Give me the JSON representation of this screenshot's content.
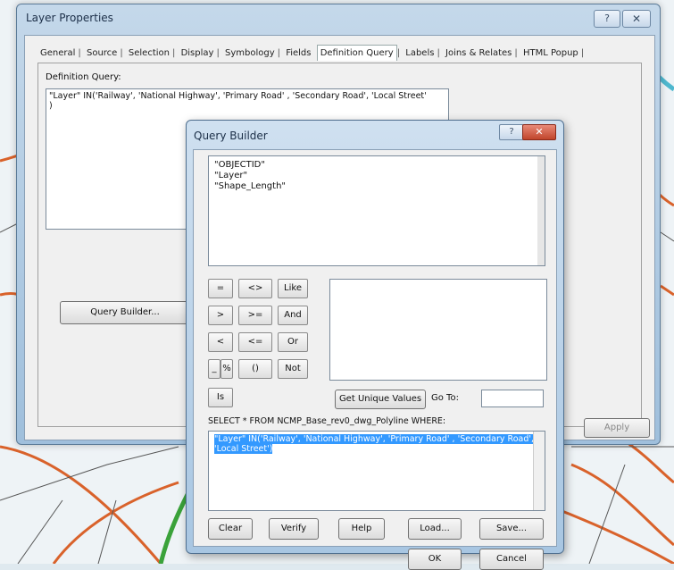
{
  "layer_properties": {
    "title": "Layer Properties",
    "help_glyph": "?",
    "close_glyph": "✕",
    "tabs": [
      "General",
      "Source",
      "Selection",
      "Display",
      "Symbology",
      "Fields",
      "Definition Query",
      "Labels",
      "Joins & Relates",
      "HTML Popup"
    ],
    "active_tab": "Definition Query",
    "definition_query_label": "Definition Query:",
    "definition_query_text": "\"Layer\" IN('Railway', 'National Highway', 'Primary Road' , 'Secondary Road', 'Local Street'",
    "definition_query_text_line2": ")",
    "query_builder_button": "Query Builder...",
    "apply_button": "Apply"
  },
  "query_builder": {
    "title": "Query Builder",
    "help_glyph": "?",
    "close_glyph": "✕",
    "fields": [
      "\"OBJECTID\"",
      "\"Layer\"",
      "\"Shape_Length\""
    ],
    "operators": [
      "=",
      "<>",
      "Like",
      ">",
      ">=",
      "And",
      "<",
      "<=",
      "Or",
      "_",
      "%",
      "()",
      "Not",
      "Is"
    ],
    "get_unique_values": "Get Unique Values",
    "goto_label": "Go To:",
    "select_statement": "SELECT * FROM NCMP_Base_rev0_dwg_Polyline WHERE:",
    "where_text": "\"Layer\" IN('Railway', 'National Highway', 'Primary Road' , 'Secondary Road', 'Local Street')",
    "buttons": {
      "clear": "Clear",
      "verify": "Verify",
      "help": "Help",
      "load": "Load...",
      "save": "Save...",
      "ok": "OK",
      "cancel": "Cancel"
    }
  },
  "colors": {
    "road_orange": "#d9622b",
    "road_green": "#3aa23a",
    "road_cyan": "#4fb8cf",
    "selection_blue": "#3399ff"
  }
}
